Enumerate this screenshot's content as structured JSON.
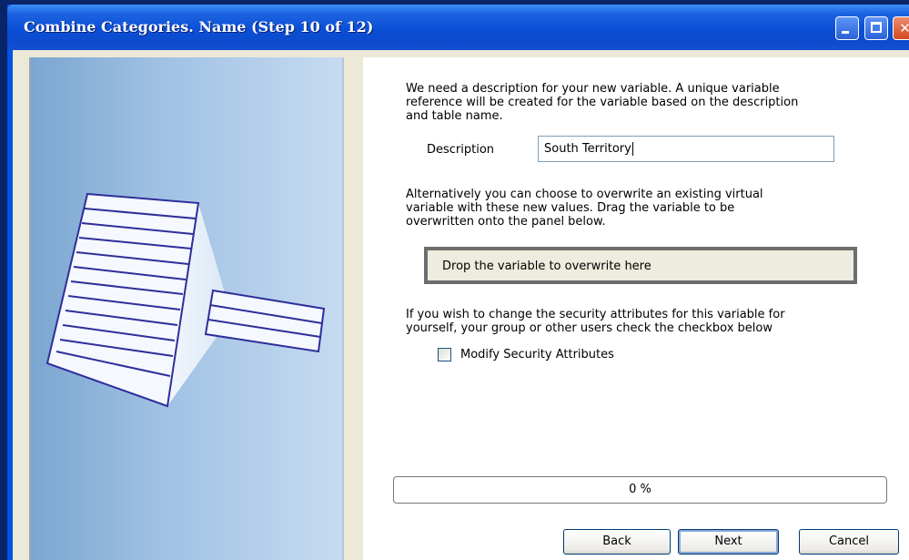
{
  "window": {
    "title": "Combine Categories.  Name (Step 10 of 12)",
    "min_glyph": "",
    "max_glyph": "",
    "close_glyph": "✕"
  },
  "content": {
    "intro_text_1": "We need a description for your new variable.  A unique variable",
    "intro_text_2": "reference will be created for the variable based on the description",
    "intro_text_3": "and table name.",
    "description_label": "Description",
    "description_value": "South Territory",
    "alt_text_1": "Alternatively you can choose to overwrite an existing virtual",
    "alt_text_2": "variable with these new values. Drag the variable to be",
    "alt_text_3": "overwritten onto the panel below.",
    "drop_zone_text": "Drop the variable to overwrite here",
    "security_text_1": "If you wish to change the security attributes for this variable for",
    "security_text_2": "yourself, your group or other users check the checkbox below",
    "checkbox_label": "Modify Security Attributes",
    "checkbox_checked": false,
    "progress_text": "0 %",
    "progress_value": 0
  },
  "buttons": {
    "back": "Back",
    "next": "Next",
    "cancel": "Cancel"
  },
  "icons": {
    "wizard_graphic": "table-combine-illustration",
    "minimize": "minimize-icon",
    "maximize": "maximize-icon",
    "close": "close-icon"
  }
}
